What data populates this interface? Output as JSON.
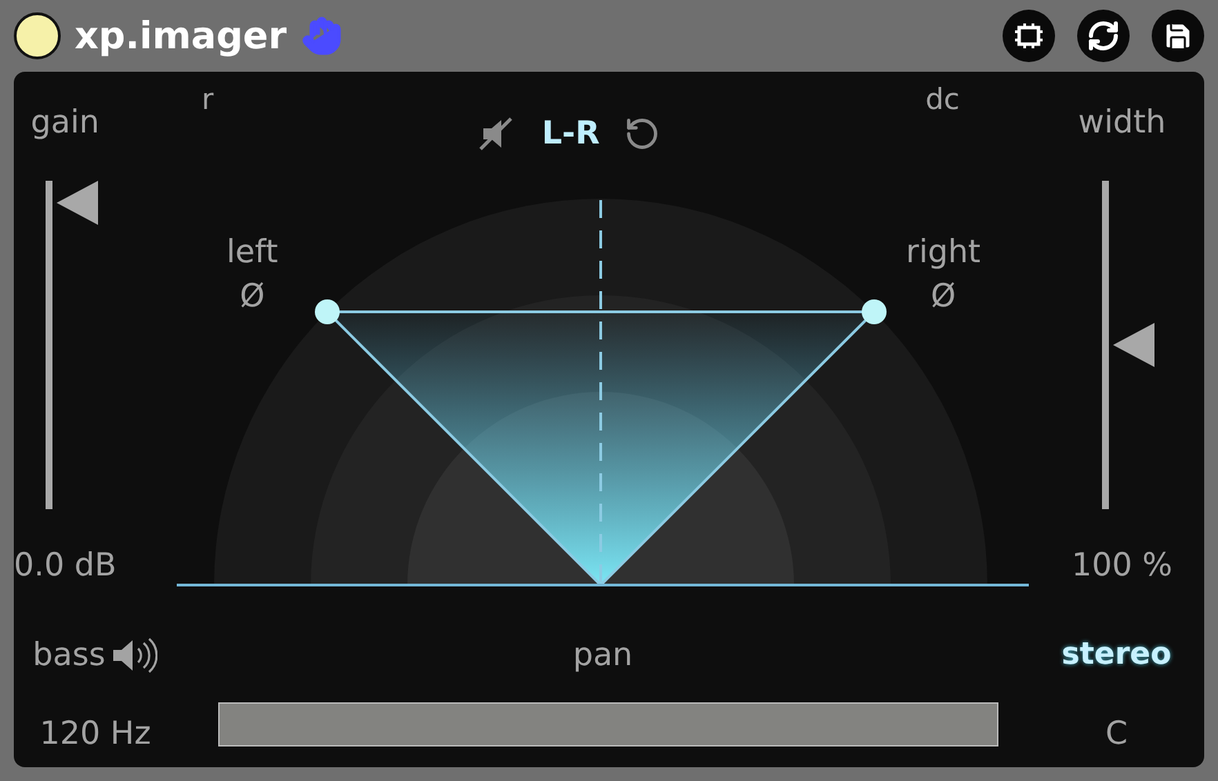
{
  "window": {
    "title": "xp.imager"
  },
  "corners": {
    "top_left": "r",
    "top_right": "dc"
  },
  "mode": {
    "label": "L-R",
    "muted": true
  },
  "sliders": [
    {
      "label": "gain",
      "level": 0.93,
      "reading": "0.0 dB"
    },
    {
      "label": "width",
      "level": 0.5,
      "reading": "100 %"
    }
  ],
  "channels": [
    {
      "label": "left",
      "phase": "Ø"
    },
    {
      "label": "right",
      "phase": "Ø"
    }
  ],
  "bass": {
    "label": "bass",
    "value": "120 Hz"
  },
  "pan": {
    "label": "pan",
    "value": "C"
  },
  "stereo": {
    "label": "stereo",
    "on": true
  }
}
